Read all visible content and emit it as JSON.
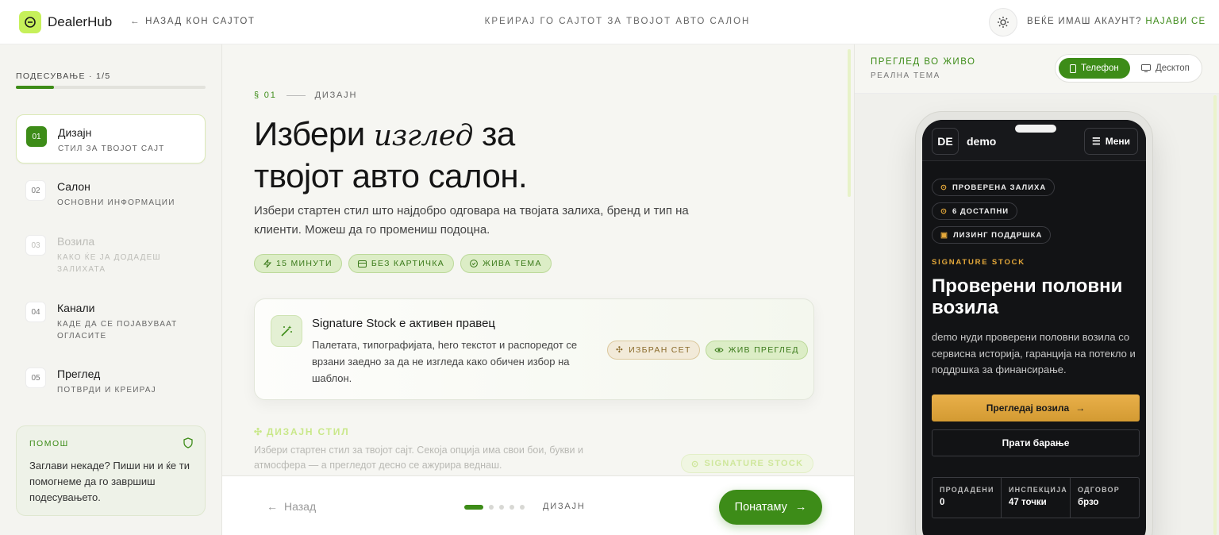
{
  "topbar": {
    "brand": "DealerHub",
    "back_link": "НАЗАД КОН САЈТОТ",
    "center_title": "КРЕИРАЈ ГО САЈТОТ ЗА ТВОЈОТ АВТО САЛОН",
    "account_prompt": "ВЕЌЕ ИМАШ АКАУНТ?",
    "login_link": "НАЈАВИ СЕ",
    "icons": {
      "logo": "logo-icon",
      "back": "arrow-left-icon",
      "theme": "sun-icon"
    }
  },
  "sidebar": {
    "progress_label": "ПОДЕСУВАЊЕ · 1/5",
    "progress_fraction": 0.2,
    "steps": [
      {
        "num": "01",
        "title": "Дизајн",
        "sub": "СТИЛ ЗА ТВОЈОТ САЈТ"
      },
      {
        "num": "02",
        "title": "Салон",
        "sub": "ОСНОВНИ ИНФОРМАЦИИ"
      },
      {
        "num": "03",
        "title": "Возила",
        "sub": "КАКО ЌЕ ЈА ДОДАДЕШ ЗАЛИХАТА"
      },
      {
        "num": "04",
        "title": "Канали",
        "sub": "КАДЕ ДА СЕ ПОЈАВУВААТ ОГЛАСИТЕ"
      },
      {
        "num": "05",
        "title": "Преглед",
        "sub": "ПОТВРДИ И КРЕИРАЈ"
      }
    ],
    "help": {
      "title": "ПОМОШ",
      "text": "Заглави некаде? Пиши ни и ќе ти помогнеме да го завршиш подесувањето."
    }
  },
  "main": {
    "section_num": "§ 01",
    "section_name": "ДИЗАЈН",
    "headline_a": "Избери",
    "headline_em": "изглед",
    "headline_b": "за",
    "headline_c": "твојот авто салон.",
    "lead": "Избери стартен стил што најдобро одговара на твојата залиха, бренд и тип на клиенти. Можеш да го промениш подоцна.",
    "chips": [
      "15 МИНУТИ",
      "БЕЗ КАРТИЧКА",
      "ЖИВА ТЕМА"
    ],
    "card": {
      "title": "Signature Stock е активен правец",
      "desc": "Палетата, типографијата, hero текстот и распоредот се врзани заедно за да не изгледа како обичен избор на шаблон.",
      "badge_set": "ИЗБРАН СЕТ",
      "badge_live": "ЖИВ ПРЕГЛЕД"
    },
    "style_title": "ДИЗАЈН СТИЛ",
    "style_text": "Избери стартен стил за твојот сајт. Секоја опција има свои бои, букви и атмосфера — а прегледот десно се ажурира веднаш.",
    "style_badge": "SIGNATURE STOCK"
  },
  "footer": {
    "back": "Назад",
    "step_label": "ДИЗАЈН",
    "next": "Понатаму",
    "dots_total": 5,
    "dots_active": 1
  },
  "preview": {
    "title": "ПРЕГЛЕД ВО ЖИВО",
    "subtitle": "РЕАЛНА ТЕМА",
    "toggle_phone": "Телефон",
    "toggle_desktop": "Десктоп",
    "phone": {
      "logo": "DE",
      "name": "demo",
      "menu": "Мени",
      "pills": [
        "ПРОВЕРЕНА ЗАЛИХА",
        "6 ДОСТАПНИ",
        "ЛИЗИНГ ПОДДРШКА"
      ],
      "kicker": "SIGNATURE STOCK",
      "headline": "Проверени половни возила",
      "paragraph": "demo нуди проверени половни возила со сервисна историја, гаранција на потекло и поддршка за финансирање.",
      "btn_primary": "Прегледај возила",
      "btn_secondary": "Прати барање",
      "stats": [
        {
          "label": "ПРОДАДЕНИ",
          "value": "0"
        },
        {
          "label": "ИНСПЕКЦИЈА",
          "value": "47 точки"
        },
        {
          "label": "ОДГОВОР",
          "value": "брзо"
        }
      ]
    }
  },
  "colors": {
    "accent": "#3d8c18",
    "lime": "#c6f05a",
    "gold": "#e4a83a",
    "dark": "#121315"
  }
}
